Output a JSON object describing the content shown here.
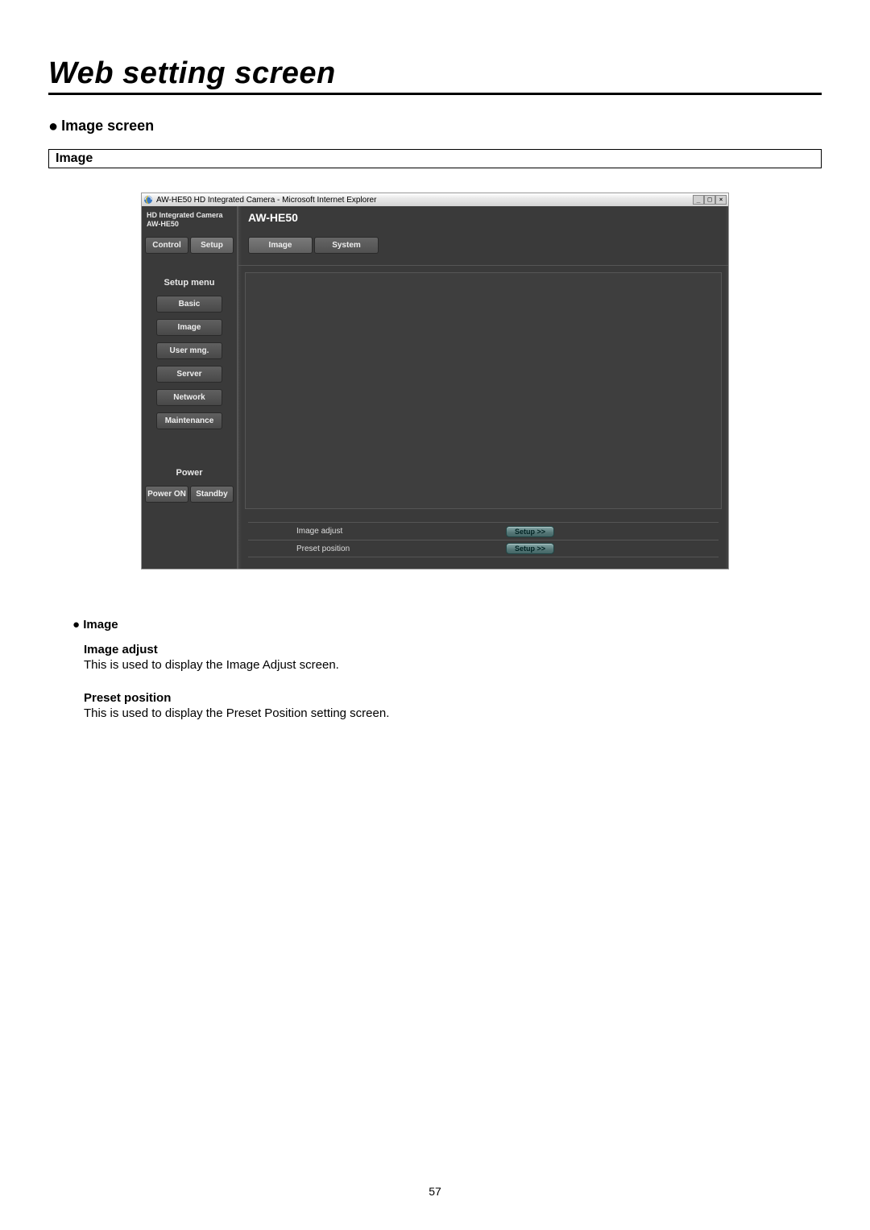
{
  "page": {
    "title": "Web setting screen",
    "section": "Image screen",
    "subsection_box": "Image",
    "number": "57"
  },
  "shot": {
    "titlebar": "AW-HE50 HD Integrated Camera - Microsoft Internet Explorer",
    "device_label": "HD Integrated Camera\nAW-HE50",
    "main_title": "AW-HE50",
    "top_tabs": {
      "control": "Control",
      "setup": "Setup"
    },
    "menu_header": "Setup menu",
    "menu_items": [
      "Basic",
      "Image",
      "User mng.",
      "Server",
      "Network",
      "Maintenance"
    ],
    "power_header": "Power",
    "power_buttons": {
      "on": "Power ON",
      "standby": "Standby"
    },
    "main_tabs": {
      "image": "Image",
      "system": "System"
    },
    "rows": [
      {
        "label": "Image adjust",
        "button": "Setup >>"
      },
      {
        "label": "Preset position",
        "button": "Setup >>"
      }
    ]
  },
  "desc": {
    "heading": "Image",
    "items": [
      {
        "term": "Image adjust",
        "def": "This is used to display the Image Adjust screen."
      },
      {
        "term": "Preset position",
        "def": "This is used to display the Preset Position setting screen."
      }
    ]
  }
}
